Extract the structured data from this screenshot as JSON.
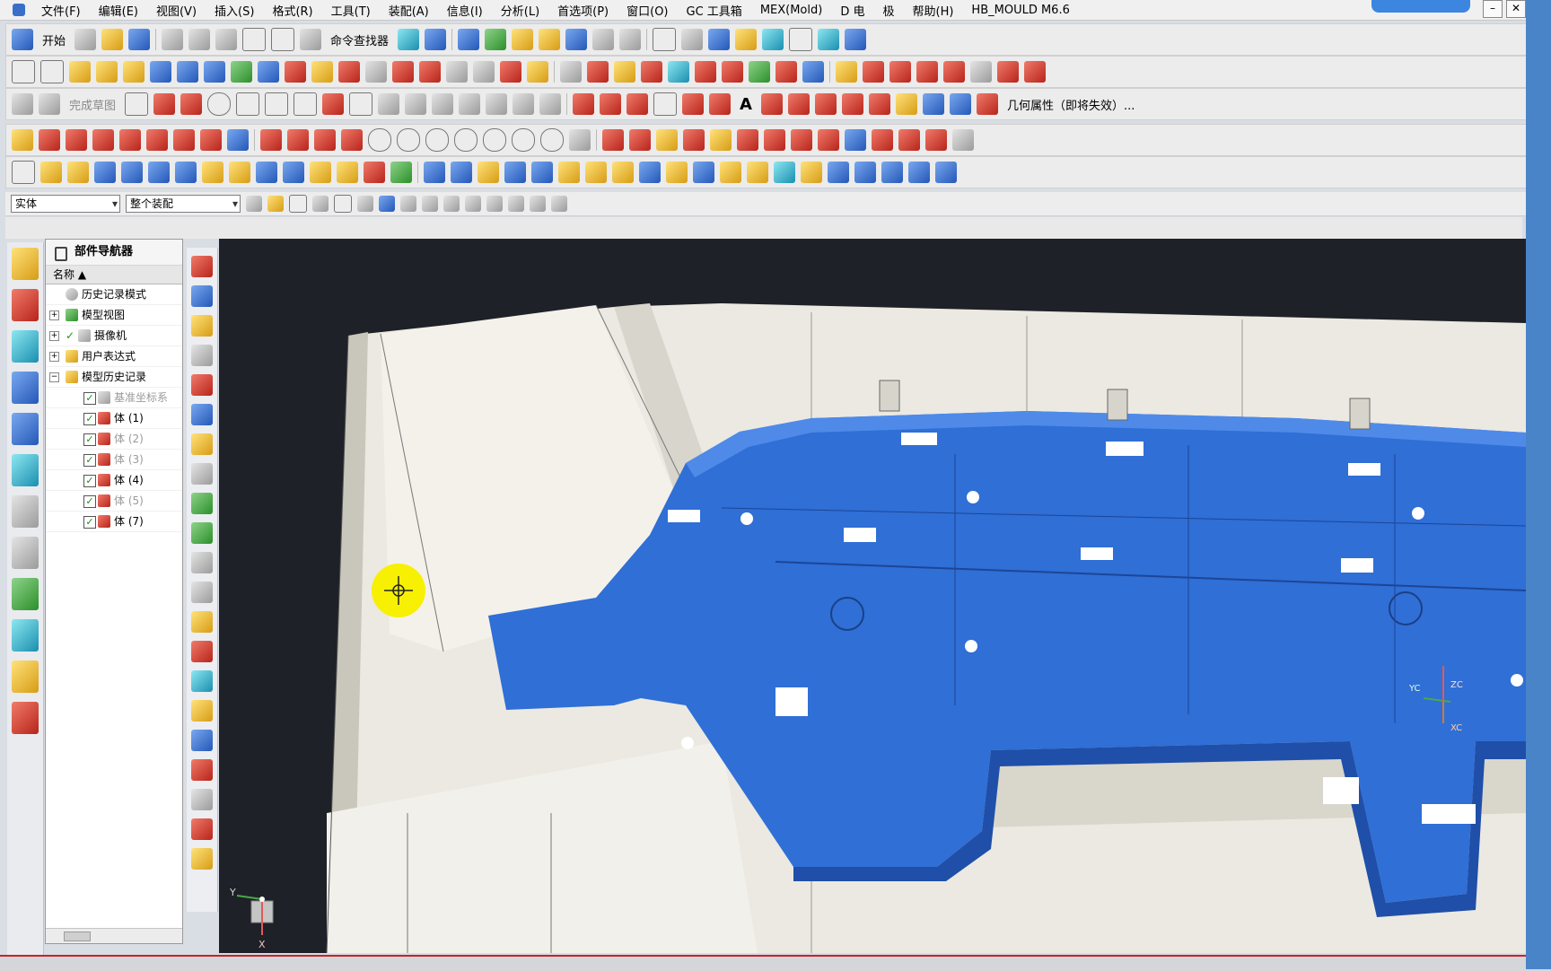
{
  "menus": [
    "文件(F)",
    "编辑(E)",
    "视图(V)",
    "插入(S)",
    "格式(R)",
    "工具(T)",
    "装配(A)",
    "信息(I)",
    "分析(L)",
    "首选项(P)",
    "窗口(O)",
    "GC 工具箱",
    "MEX(Mold)",
    "D 电",
    "极",
    "帮助(H)",
    "HB_MOULD M6.6"
  ],
  "toolbar": {
    "start_label": "开始",
    "command_finder_label": "命令查找器",
    "finish_sketch_label": "完成草图",
    "geometry_properties_label": "几何属性（即将失效）..."
  },
  "filter": {
    "type_value": "实体",
    "scope_value": "整个装配"
  },
  "navigator": {
    "title": "部件导航器",
    "column_header": "名称",
    "items": [
      {
        "label": "历史记录模式"
      },
      {
        "label": "模型视图"
      },
      {
        "label": "摄像机"
      },
      {
        "label": "用户表达式"
      },
      {
        "label": "模型历史记录"
      },
      {
        "label": "基准坐标系"
      },
      {
        "label": "体 (1)"
      },
      {
        "label": "体 (2)"
      },
      {
        "label": "体 (3)"
      },
      {
        "label": "体 (4)"
      },
      {
        "label": "体 (5)"
      },
      {
        "label": "体 (7)"
      }
    ]
  },
  "viewport": {
    "triad_labels": [
      "Y",
      "X"
    ],
    "work_csys_labels": [
      "YC",
      "ZC",
      "XC"
    ]
  },
  "colors": {
    "part_blue": "#2f6fd6",
    "mold_white": "#ebe9e1",
    "viewport_bg": "#1e2127",
    "cursor_yellow": "#f7f000"
  }
}
